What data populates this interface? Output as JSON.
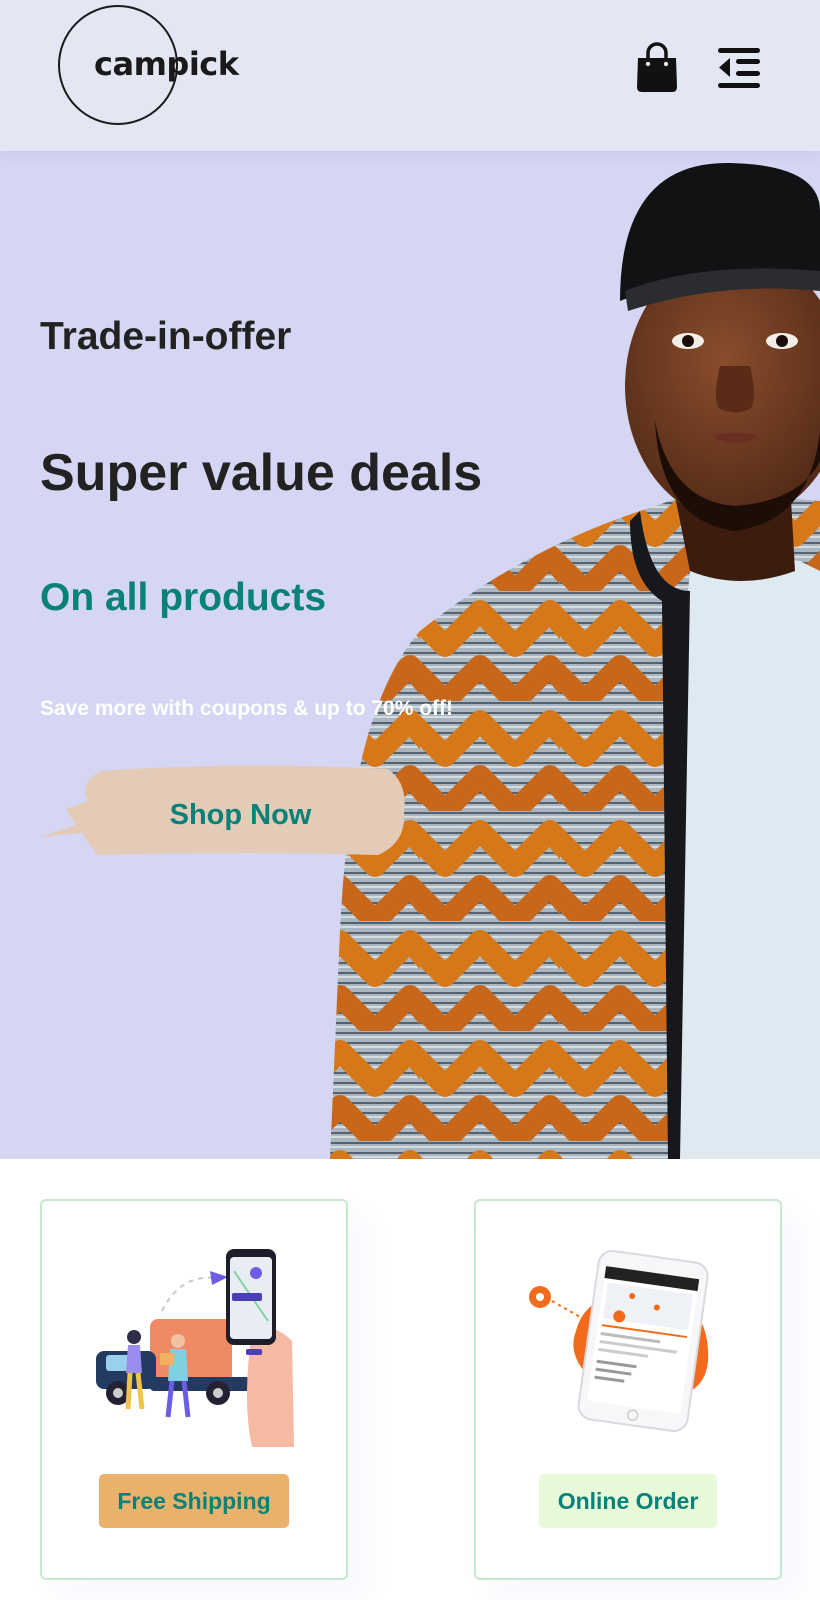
{
  "header": {
    "logo_text": "campick",
    "icons": {
      "cart": "shopping-bag-icon",
      "menu": "menu-collapse-icon"
    }
  },
  "hero": {
    "kicker": "Trade-in-offer",
    "headline": "Super value deals",
    "subheadline": "On all products",
    "description": "Save more with coupons & up to 70% off!",
    "cta_label": "Shop Now"
  },
  "features": [
    {
      "label": "Free Shipping",
      "icon": "delivery-illustration"
    },
    {
      "label": "Online Order",
      "icon": "phone-order-illustration"
    }
  ],
  "colors": {
    "accent": "#088178",
    "header_bg": "#e3e6f3",
    "hero_bg": "#d4d6f3",
    "shipping_badge": "#e9b26c",
    "order_badge": "#e6f9d8"
  }
}
